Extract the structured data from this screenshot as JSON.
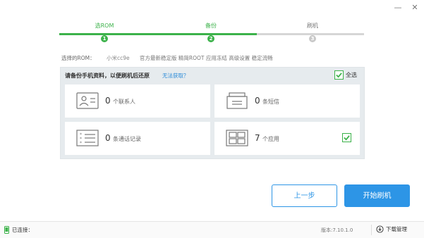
{
  "window": {
    "minimize_icon": "minimize-icon",
    "close_icon": "close-icon",
    "minimize_glyph": "—",
    "close_glyph": "✕"
  },
  "stepper": {
    "steps": [
      {
        "label": "选ROM",
        "number": "1",
        "state": "done"
      },
      {
        "label": "备份",
        "number": "2",
        "state": "current"
      },
      {
        "label": "刷机",
        "number": "3",
        "state": "pending"
      }
    ],
    "accent": "#3cb24a"
  },
  "rom": {
    "label": "选择的ROM：",
    "name": "小米cc9e",
    "description": "官方最新稳定版 精简ROOT 应用冻结 高级设置 稳定流畅"
  },
  "backup": {
    "title": "请备份手机资料，以便刷机后还原",
    "help_link": "无法获取？",
    "select_all_label": "全选",
    "select_all_checked": true,
    "items": [
      {
        "icon": "contacts-card-icon",
        "count": "0",
        "label": "个联系人",
        "checked": false
      },
      {
        "icon": "sms-envelope-icon",
        "count": "0",
        "label": "条短信",
        "checked": false
      },
      {
        "icon": "call-log-list-icon",
        "count": "0",
        "label": "条通话记录",
        "checked": false
      },
      {
        "icon": "apps-grid-icon",
        "count": "7",
        "label": "个应用",
        "checked": true
      }
    ]
  },
  "buttons": {
    "prev": "上一步",
    "start": "开始刷机"
  },
  "status": {
    "connection": "已连接：",
    "version": "版本:7.10.1.0",
    "download_manager": "下载管理"
  },
  "colors": {
    "primary_blue": "#2d95e6",
    "green": "#3cb24a",
    "panel_bg": "#e6ebee"
  }
}
